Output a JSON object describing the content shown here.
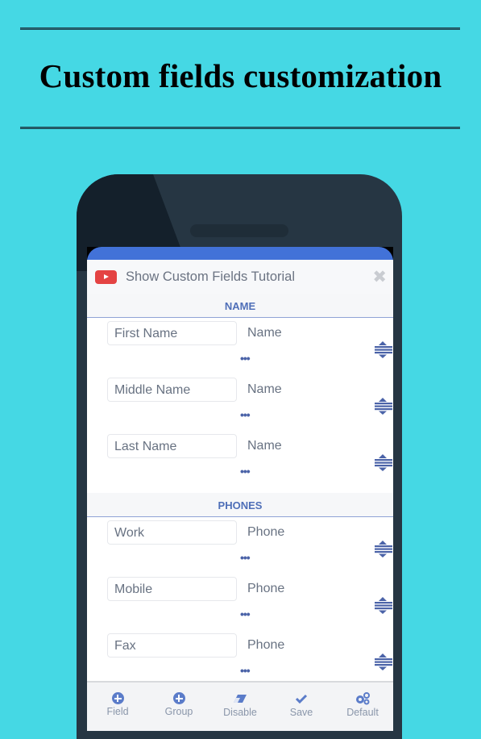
{
  "headline": "Custom fields customization",
  "app": {
    "tutorial_label": "Show Custom Fields Tutorial",
    "close_glyph": "✖",
    "groups": [
      {
        "title": "NAME",
        "fields": [
          {
            "label": "First Name",
            "type": "Name",
            "more": "•••"
          },
          {
            "label": "Middle Name",
            "type": "Name",
            "more": "•••"
          },
          {
            "label": "Last Name",
            "type": "Name",
            "more": "•••"
          }
        ]
      },
      {
        "title": "PHONES",
        "fields": [
          {
            "label": "Work",
            "type": "Phone",
            "more": "•••"
          },
          {
            "label": "Mobile",
            "type": "Phone",
            "more": "•••"
          },
          {
            "label": "Fax",
            "type": "Phone",
            "more": "•••"
          }
        ]
      }
    ],
    "toolbar": [
      {
        "label": "Field",
        "icon": "plus-circle"
      },
      {
        "label": "Group",
        "icon": "plus-circle"
      },
      {
        "label": "Disable",
        "icon": "eraser"
      },
      {
        "label": "Save",
        "icon": "check"
      },
      {
        "label": "Default",
        "icon": "gears"
      }
    ]
  },
  "colors": {
    "background": "#45d8e4",
    "accent": "#4272d8",
    "section_title": "#4f6fb8",
    "youtube_red": "#e44343"
  }
}
